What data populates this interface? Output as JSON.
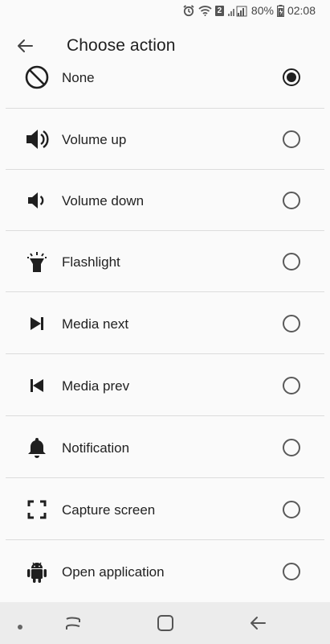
{
  "status_bar": {
    "badge": "2",
    "battery_percent": "80%",
    "time": "02:08",
    "icons": [
      "alarm-icon",
      "wifi-icon",
      "signal-icon",
      "battery-charging-icon"
    ]
  },
  "app_bar": {
    "back_icon": "arrow-back-icon",
    "title": "Choose action"
  },
  "actions": [
    {
      "label": "None",
      "icon": "block-icon",
      "selected": true
    },
    {
      "label": "Volume up",
      "icon": "volume-up-icon",
      "selected": false
    },
    {
      "label": "Volume down",
      "icon": "volume-down-icon",
      "selected": false
    },
    {
      "label": "Flashlight",
      "icon": "flashlight-icon",
      "selected": false
    },
    {
      "label": "Media next",
      "icon": "skip-next-icon",
      "selected": false
    },
    {
      "label": "Media prev",
      "icon": "skip-previous-icon",
      "selected": false
    },
    {
      "label": "Notification",
      "icon": "bell-icon",
      "selected": false
    },
    {
      "label": "Capture screen",
      "icon": "capture-screen-icon",
      "selected": false
    },
    {
      "label": "Open application",
      "icon": "android-icon",
      "selected": false
    }
  ],
  "nav_bar": {
    "icons": [
      "nav-dot-icon",
      "recents-icon",
      "home-icon",
      "back-icon"
    ]
  },
  "colors": {
    "background": "#fafafa",
    "divider": "#dcdcdc",
    "text": "#1f1f1f",
    "nav_bar": "#ececec"
  }
}
